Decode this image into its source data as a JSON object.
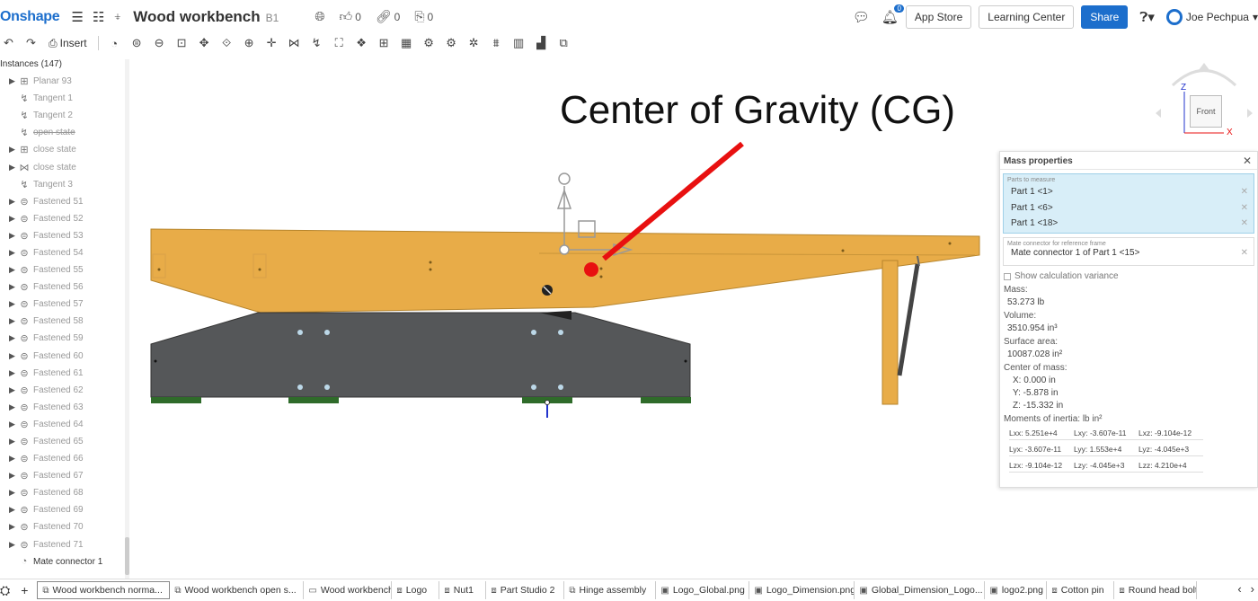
{
  "app": {
    "logo": "Onshape",
    "doc_title": "Wood workbench",
    "branch": "B1",
    "likes": "0",
    "links": "0",
    "copies": "0",
    "notification_count": "0",
    "app_store": "App Store",
    "learning_center": "Learning Center",
    "share": "Share",
    "user_name": "Joe Pechpua"
  },
  "toolbar": {
    "insert_label": "Insert",
    "tools": [
      "undo-icon",
      "redo-icon",
      "insert-icon",
      "mate-connector-icon",
      "fastened-mate-icon",
      "revolute-mate-icon",
      "slider-mate-icon",
      "planar-mate-icon",
      "cylindrical-mate-icon",
      "pin-slot-mate-icon",
      "ball-mate-icon",
      "parallel-mate-icon",
      "tangent-mate-icon",
      "group-icon",
      "replicate-icon",
      "mate-connector-alt-icon",
      "pattern-icon",
      "gear-relation-icon",
      "rack-pinion-icon",
      "screw-relation-icon",
      "linear-relation-icon",
      "explode-icon",
      "section-icon",
      "measure-icon"
    ]
  },
  "instances": {
    "header": "Instances (147)",
    "items": [
      {
        "label": "Planar 93",
        "icon": "planar",
        "arrow": true
      },
      {
        "label": "Tangent 1",
        "icon": "tangent",
        "arrow": false
      },
      {
        "label": "Tangent 2",
        "icon": "tangent",
        "arrow": false
      },
      {
        "label": "open state",
        "icon": "tangent",
        "arrow": false,
        "strike": true
      },
      {
        "label": "close state",
        "icon": "planar",
        "arrow": true
      },
      {
        "label": "close state",
        "icon": "slider",
        "arrow": true
      },
      {
        "label": "Tangent 3",
        "icon": "tangent",
        "arrow": false
      },
      {
        "label": "Fastened 51",
        "icon": "fastened",
        "arrow": true
      },
      {
        "label": "Fastened 52",
        "icon": "fastened",
        "arrow": true
      },
      {
        "label": "Fastened 53",
        "icon": "fastened",
        "arrow": true
      },
      {
        "label": "Fastened 54",
        "icon": "fastened",
        "arrow": true
      },
      {
        "label": "Fastened 55",
        "icon": "fastened",
        "arrow": true
      },
      {
        "label": "Fastened 56",
        "icon": "fastened",
        "arrow": true
      },
      {
        "label": "Fastened 57",
        "icon": "fastened",
        "arrow": true
      },
      {
        "label": "Fastened 58",
        "icon": "fastened",
        "arrow": true
      },
      {
        "label": "Fastened 59",
        "icon": "fastened",
        "arrow": true
      },
      {
        "label": "Fastened 60",
        "icon": "fastened",
        "arrow": true
      },
      {
        "label": "Fastened 61",
        "icon": "fastened",
        "arrow": true
      },
      {
        "label": "Fastened 62",
        "icon": "fastened",
        "arrow": true
      },
      {
        "label": "Fastened 63",
        "icon": "fastened",
        "arrow": true
      },
      {
        "label": "Fastened 64",
        "icon": "fastened",
        "arrow": true
      },
      {
        "label": "Fastened 65",
        "icon": "fastened",
        "arrow": true
      },
      {
        "label": "Fastened 66",
        "icon": "fastened",
        "arrow": true
      },
      {
        "label": "Fastened 67",
        "icon": "fastened",
        "arrow": true
      },
      {
        "label": "Fastened 68",
        "icon": "fastened",
        "arrow": true
      },
      {
        "label": "Fastened 69",
        "icon": "fastened",
        "arrow": true
      },
      {
        "label": "Fastened 70",
        "icon": "fastened",
        "arrow": true
      },
      {
        "label": "Fastened 71",
        "icon": "fastened",
        "arrow": true
      },
      {
        "label": "Mate connector 1",
        "icon": "mate",
        "arrow": false,
        "active": true
      }
    ]
  },
  "viewport": {
    "annotation": "Center of Gravity (CG)",
    "view_cube_face": "Front",
    "axis_z": "Z",
    "axis_x": "X",
    "colors": {
      "top_wood": "#e8ac48",
      "base": "#555759",
      "feet": "#2f6b2a",
      "cg_marker": "#e81010",
      "arrow": "#e81010"
    }
  },
  "mass_properties": {
    "title": "Mass properties",
    "parts_label": "Parts to measure",
    "parts": [
      "Part 1 <1>",
      "Part 1 <6>",
      "Part 1 <18>"
    ],
    "mate_label": "Mate connector for reference frame",
    "mate_value": "Mate connector 1 of Part 1 <15>",
    "variance_label": "Show calculation variance",
    "mass_label": "Mass:",
    "mass_value": "53.273 lb",
    "volume_label": "Volume:",
    "volume_value": "3510.954 in³",
    "surface_label": "Surface area:",
    "surface_value": "10087.028 in²",
    "com_label": "Center of mass:",
    "com_x": "X: 0.000 in",
    "com_y": "Y: -5.878 in",
    "com_z": "Z: -15.332 in",
    "moments_label": "Moments of inertia: lb in²",
    "moments": [
      "Lxx: 5.251e+4",
      "Lxy: -3.607e-11",
      "Lxz: -9.104e-12",
      "Lyx: -3.607e-11",
      "Lyy: 1.553e+4",
      "Lyz: -4.045e+3",
      "Lzx: -9.104e-12",
      "Lzy: -4.045e+3",
      "Lzz: 4.210e+4"
    ]
  },
  "tabs": [
    {
      "label": "Wood workbench norma...",
      "icon": "assembly",
      "active": true
    },
    {
      "label": "Wood workbench open s...",
      "icon": "assembly",
      "active": false
    },
    {
      "label": "Wood workbench",
      "icon": "drawing",
      "active": false
    },
    {
      "label": "Logo",
      "icon": "part-studio",
      "active": false
    },
    {
      "label": "Nut1",
      "icon": "part-studio",
      "active": false
    },
    {
      "label": "Part Studio 2",
      "icon": "part-studio",
      "active": false
    },
    {
      "label": "Hinge assembly",
      "icon": "assembly",
      "active": false
    },
    {
      "label": "Logo_Global.png",
      "icon": "image",
      "active": false
    },
    {
      "label": "Logo_Dimension.png",
      "icon": "image",
      "active": false
    },
    {
      "label": "Global_Dimension_Logo...",
      "icon": "image",
      "active": false
    },
    {
      "label": "logo2.png",
      "icon": "image",
      "active": false
    },
    {
      "label": "Cotton pin",
      "icon": "part-studio",
      "active": false
    },
    {
      "label": "Round head bolt",
      "icon": "part-studio",
      "active": false
    }
  ]
}
